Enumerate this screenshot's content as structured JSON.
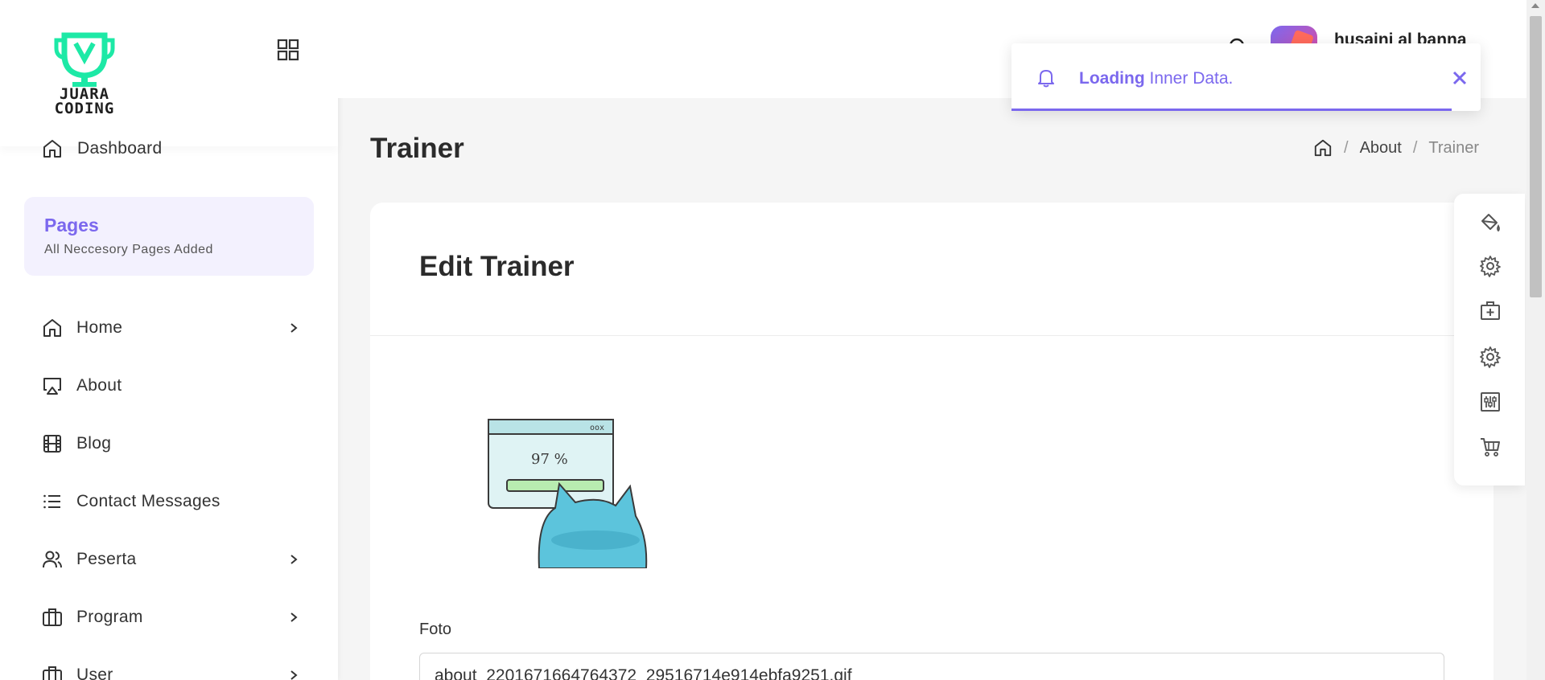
{
  "brand": {
    "logo_text_line1": "JUARA",
    "logo_text_line2": "CODING"
  },
  "sidebar": {
    "dashboard_label": "Dashboard",
    "pages_card": {
      "title": "Pages",
      "subtitle": "All Neccesory Pages Added"
    },
    "items": [
      {
        "label": "Home",
        "icon": "home-icon",
        "has_chevron": true
      },
      {
        "label": "About",
        "icon": "airplay-icon",
        "has_chevron": false
      },
      {
        "label": "Blog",
        "icon": "film-icon",
        "has_chevron": false
      },
      {
        "label": "Contact Messages",
        "icon": "list-icon",
        "has_chevron": false
      },
      {
        "label": "Peserta",
        "icon": "users-icon",
        "has_chevron": true
      },
      {
        "label": "Program",
        "icon": "briefcase-icon",
        "has_chevron": true
      },
      {
        "label": "User",
        "icon": "briefcase-icon",
        "has_chevron": true
      }
    ]
  },
  "header": {
    "user_name": "husaini al banna"
  },
  "toast": {
    "strong": "Loading",
    "text": " Inner Data."
  },
  "page": {
    "title": "Trainer",
    "breadcrumb": [
      "About",
      "Trainer"
    ]
  },
  "card": {
    "title": "Edit Trainer",
    "image_caption": "97 %",
    "foto_label": "Foto",
    "foto_value": "about_2201671664764372_29516714e914ebfa9251.gif"
  },
  "toolbar": {
    "icons": [
      "paint-bucket-icon",
      "gear-icon",
      "medical-box-icon",
      "gear-icon",
      "sliders-icon",
      "cart-icon"
    ]
  },
  "colors": {
    "accent": "#7b68ee",
    "logo_green": "#1de9a6"
  }
}
